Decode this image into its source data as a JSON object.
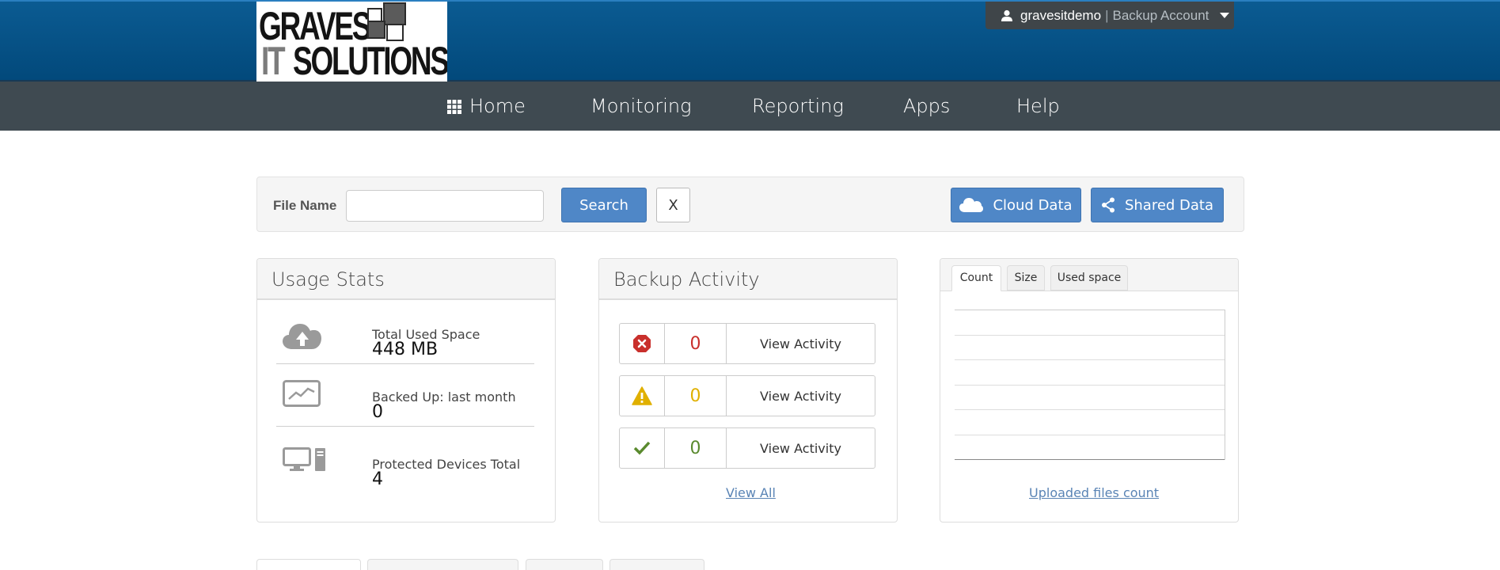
{
  "brand": {
    "logo_line1": "GRAVES",
    "logo_it": "IT",
    "logo_line2": "SOLUTIONS"
  },
  "account": {
    "username": "gravesitdemo",
    "separator": "|",
    "role": "Backup Account"
  },
  "nav": {
    "items": [
      {
        "label": "Home"
      },
      {
        "label": "Monitoring"
      },
      {
        "label": "Reporting"
      },
      {
        "label": "Apps"
      },
      {
        "label": "Help"
      }
    ]
  },
  "search": {
    "label": "File Name",
    "value": "",
    "placeholder": "",
    "search_button": "Search",
    "clear_button": "X",
    "cloud_button": "Cloud Data",
    "shared_button": "Shared Data"
  },
  "usage_stats": {
    "title": "Usage Stats",
    "items": [
      {
        "label": "Total Used Space",
        "value": "448 MB",
        "icon": "cloud-upload-icon"
      },
      {
        "label": "Backed Up: last month",
        "value": "0",
        "icon": "chart-line-icon"
      },
      {
        "label": "Protected Devices Total",
        "value": "4",
        "icon": "devices-icon"
      }
    ]
  },
  "backup_activity": {
    "title": "Backup Activity",
    "rows": [
      {
        "status": "error",
        "count": "0",
        "action": "View Activity",
        "color": "#c9302c"
      },
      {
        "status": "warning",
        "count": "0",
        "action": "View Activity",
        "color": "#e0b000"
      },
      {
        "status": "success",
        "count": "0",
        "action": "View Activity",
        "color": "#5a8a2e"
      }
    ],
    "view_all": "View All"
  },
  "chart_panel": {
    "tabs": [
      {
        "label": "Count",
        "active": true
      },
      {
        "label": "Size",
        "active": false
      },
      {
        "label": "Used space",
        "active": false
      }
    ],
    "link": "Uploaded files count"
  },
  "colors": {
    "header_blue": "#0b5b92",
    "nav_gray": "#3f4a51",
    "button_blue": "#4f87c7"
  }
}
